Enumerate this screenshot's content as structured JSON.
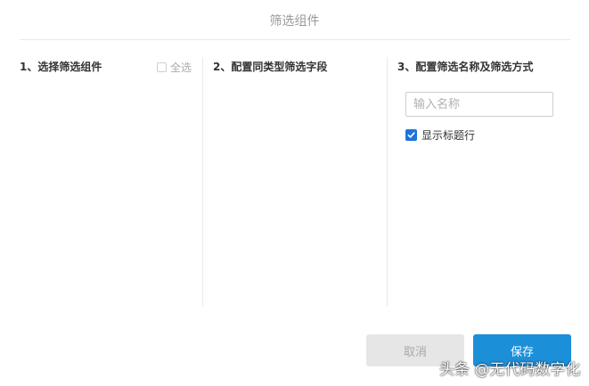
{
  "dialog": {
    "title": "筛选组件"
  },
  "columns": [
    {
      "heading": "1、选择筛选组件",
      "select_all_label": "全选"
    },
    {
      "heading": "2、配置同类型筛选字段"
    },
    {
      "heading": "3、配置筛选名称及筛选方式"
    }
  ],
  "config": {
    "name_input": {
      "value": "",
      "placeholder": "输入名称"
    },
    "show_title_row": {
      "label": "显示标题行",
      "checked": true
    }
  },
  "buttons": {
    "cancel_label": "取消",
    "save_label": "保存"
  },
  "watermark": {
    "text": "头条 @无代码数字化"
  },
  "colors": {
    "accent": "#1c8fd9",
    "checkbox": "#1e73d8",
    "disabled_bg": "#e6e6e6"
  }
}
